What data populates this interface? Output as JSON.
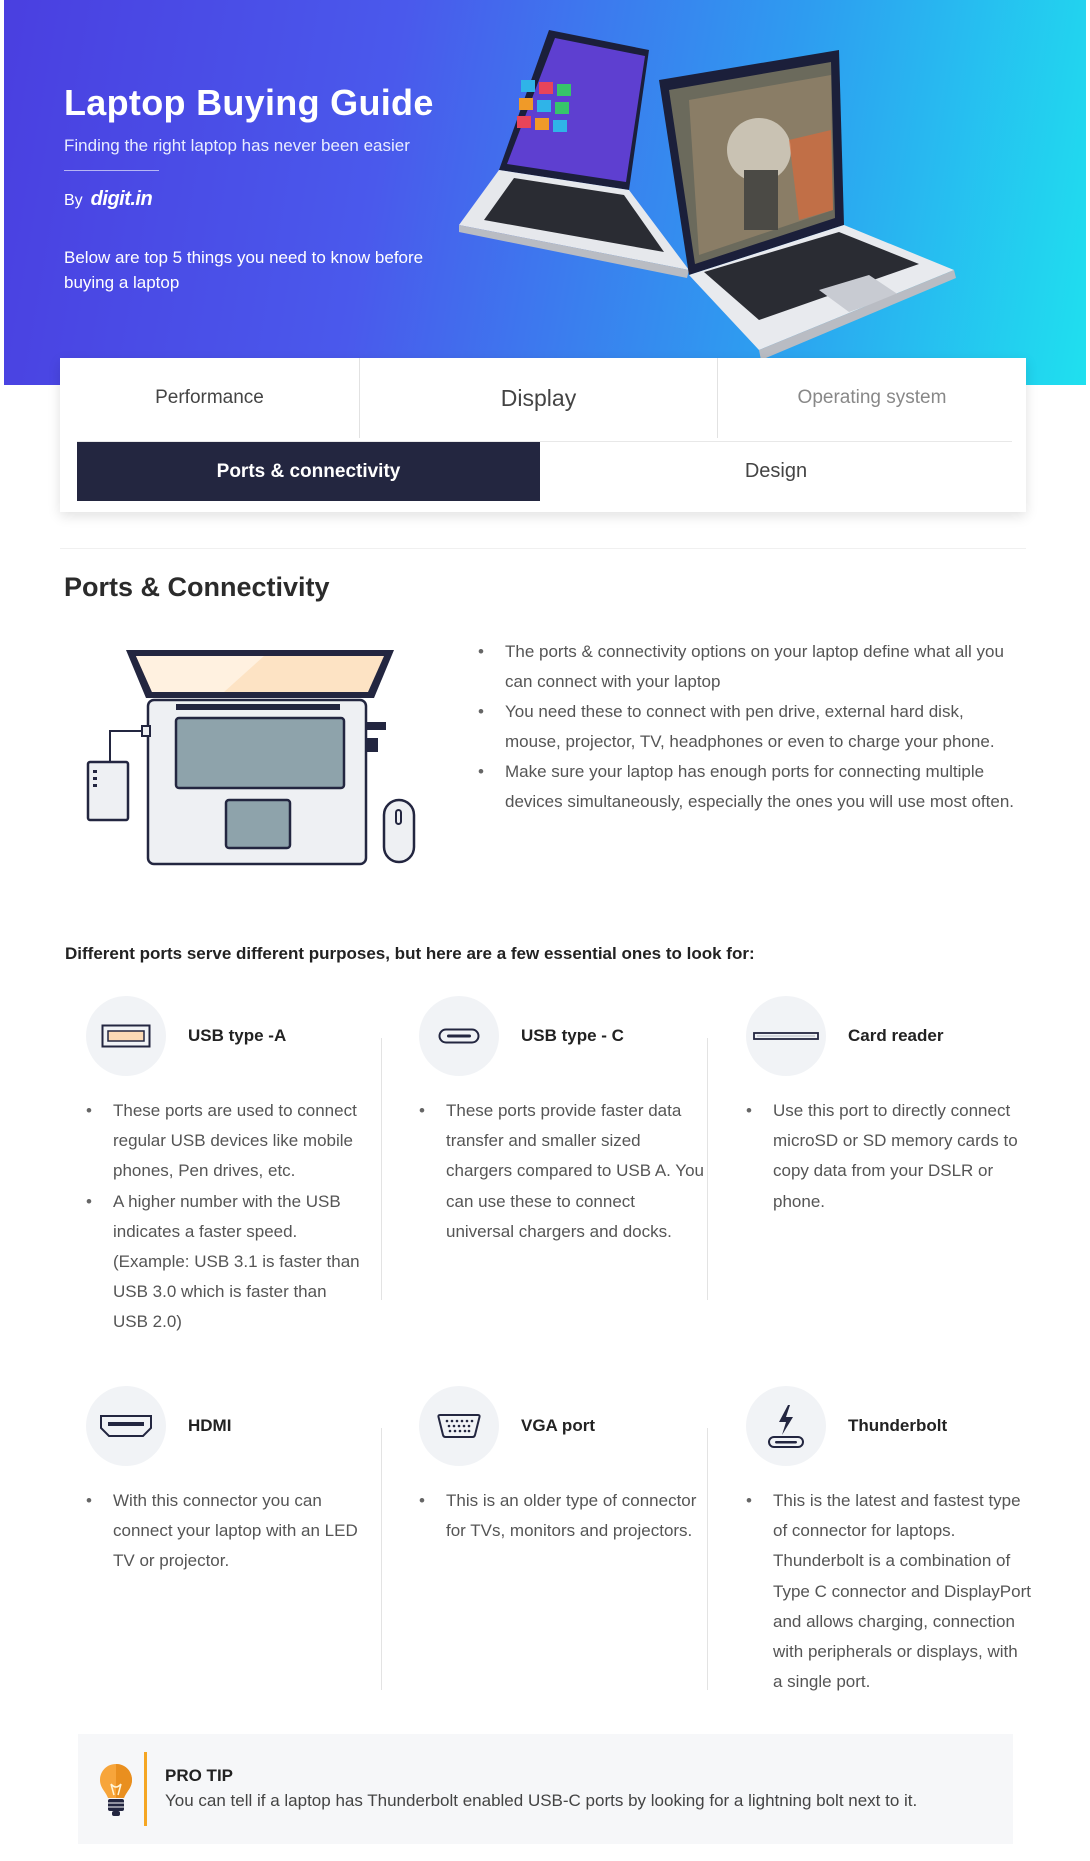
{
  "hero": {
    "title": "Laptop Buying Guide",
    "subtitle": "Finding the right laptop has never been easier",
    "by_label": "By",
    "brand": "digit.in",
    "intro": "Below are top 5 things you need to know before buying a laptop"
  },
  "tabs": {
    "performance": "Performance",
    "display": "Display",
    "os": "Operating system",
    "ports": "Ports & connectivity",
    "design": "Design",
    "active": "Ports & connectivity"
  },
  "section": {
    "title": "Ports & Connectivity",
    "intro_points": [
      "The ports & connectivity options on your laptop define what all you can connect with your laptop",
      "You need these to connect with pen drive, external hard disk, mouse, projector, TV, headphones or even to charge your phone.",
      "Make sure your laptop has enough ports for connecting multiple devices simultaneously, especially the ones you will use most often."
    ],
    "essentials_heading": "Different ports serve different purposes, but here are a few essential ones to look for:"
  },
  "ports": [
    {
      "name": "USB type -A",
      "icon": "usb-a-icon",
      "points": [
        "These ports are used to connect regular USB devices like mobile phones, Pen drives, etc.",
        "A higher number with the USB indicates a faster speed. (Example: USB 3.1 is faster than USB 3.0 which is faster than USB 2.0)"
      ]
    },
    {
      "name": "USB type - C",
      "icon": "usb-c-icon",
      "points": [
        "These ports provide faster data transfer and smaller sized chargers compared to USB A. You can use these to connect universal chargers and docks."
      ]
    },
    {
      "name": "Card reader",
      "icon": "card-reader-icon",
      "points": [
        "Use this port to directly connect microSD or SD memory cards to copy data from your DSLR or phone."
      ]
    },
    {
      "name": "HDMI",
      "icon": "hdmi-icon",
      "points": [
        "With this connector you can connect your laptop with an LED TV or projector."
      ]
    },
    {
      "name": "VGA port",
      "icon": "vga-icon",
      "points": [
        "This is an older type of connector for TVs, monitors and projectors."
      ]
    },
    {
      "name": "Thunderbolt",
      "icon": "thunderbolt-icon",
      "points": [
        "This is the latest and fastest type of connector for laptops. Thunderbolt is a combination of Type C connector and DisplayPort and allows charging, connection with peripherals or displays, with a single port."
      ]
    }
  ],
  "protip": {
    "title": "PRO TIP",
    "text": "You can tell if a laptop has Thunderbolt enabled USB-C ports by looking for a lightning bolt next to it.",
    "icon": "lightbulb-icon"
  },
  "colors": {
    "hero_gradient_start": "#4a3fe0",
    "hero_gradient_end": "#1fe0ef",
    "active_tab": "#232640",
    "protip_accent": "#f5a623"
  }
}
